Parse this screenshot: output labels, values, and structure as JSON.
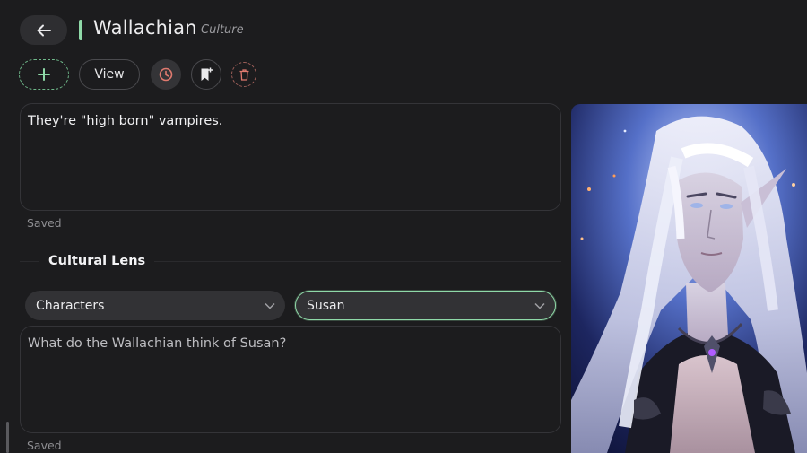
{
  "header": {
    "title": "Wallachian",
    "subtitle": "Culture",
    "accent_color": "#8fd9a8"
  },
  "toolbar": {
    "add_icon": "plus-icon",
    "view_label": "View",
    "history_icon": "clock-icon",
    "bookmark_icon": "bookmark-add-icon",
    "delete_icon": "trash-icon"
  },
  "description": {
    "value": "They're \"high born\" vampires.",
    "status": "Saved"
  },
  "cultural_lens": {
    "heading": "Cultural Lens",
    "category_select": "Characters",
    "target_select": "Susan",
    "question": "What do the Wallachian think of Susan?",
    "status": "Saved"
  },
  "image": {
    "subject": "portrait-of-silver-haired-elf"
  }
}
